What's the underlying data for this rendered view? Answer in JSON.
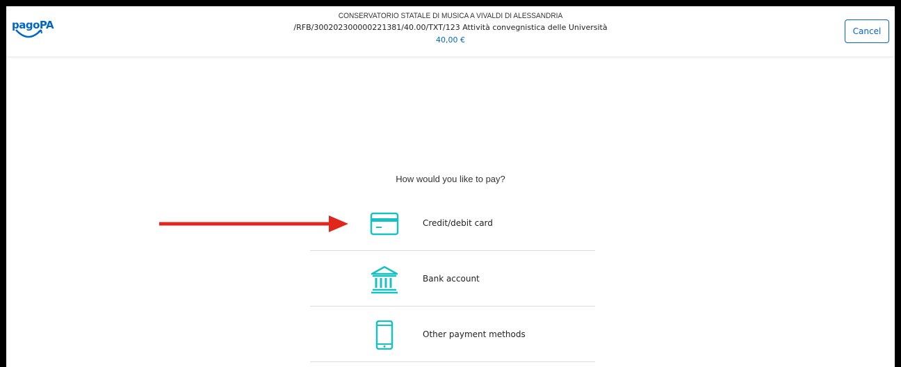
{
  "header": {
    "logo_text": "pagoPA",
    "organization": "CONSERVATORIO STATALE DI MUSICA A VIVALDI DI ALESSANDRIA",
    "description": "/RFB/300202300000221381/40.00/TXT/123 Attività convegnistica delle Università",
    "amount": "40,00 €",
    "cancel_label": "Cancel"
  },
  "main": {
    "question": "How would you like to pay?",
    "methods": [
      {
        "label": "Credit/debit card",
        "icon": "credit-card-icon"
      },
      {
        "label": "Bank account",
        "icon": "bank-icon"
      },
      {
        "label": "Other payment methods",
        "icon": "smartphone-icon"
      }
    ]
  },
  "colors": {
    "brand": "#0066cc",
    "icon_teal": "#17c1c1",
    "annotation_arrow": "#e1261c"
  }
}
